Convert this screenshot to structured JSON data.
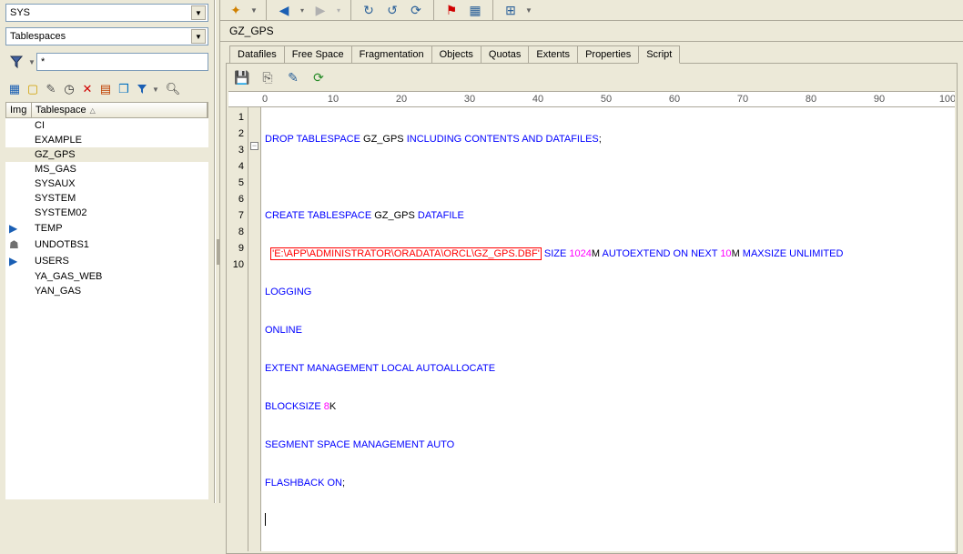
{
  "left": {
    "combo1": "SYS",
    "combo2": "Tablespaces",
    "filter_input": "*",
    "headers": {
      "img": "Img",
      "tablespace": "Tablespace"
    },
    "rows": [
      {
        "icon": "",
        "name": "CI",
        "selected": false
      },
      {
        "icon": "",
        "name": "EXAMPLE",
        "selected": false
      },
      {
        "icon": "",
        "name": "GZ_GPS",
        "selected": true
      },
      {
        "icon": "",
        "name": "MS_GAS",
        "selected": false
      },
      {
        "icon": "",
        "name": "SYSAUX",
        "selected": false
      },
      {
        "icon": "",
        "name": "SYSTEM",
        "selected": false
      },
      {
        "icon": "",
        "name": "SYSTEM02",
        "selected": false
      },
      {
        "icon": "▶",
        "name": "TEMP",
        "selected": false
      },
      {
        "icon": "☗",
        "name": "UNDOTBS1",
        "selected": false
      },
      {
        "icon": "▶",
        "name": "USERS",
        "selected": false
      },
      {
        "icon": "",
        "name": "YA_GAS_WEB",
        "selected": false
      },
      {
        "icon": "",
        "name": "YAN_GAS",
        "selected": false
      }
    ]
  },
  "title": "GZ_GPS",
  "tabs": [
    "Datafiles",
    "Free Space",
    "Fragmentation",
    "Objects",
    "Quotas",
    "Extents",
    "Properties",
    "Script"
  ],
  "active_tab": 7,
  "ruler": [
    "0",
    "10",
    "20",
    "30",
    "40",
    "50",
    "60",
    "70",
    "80",
    "90",
    "100"
  ],
  "code_lines": [
    "1",
    "2",
    "3",
    "4",
    "5",
    "6",
    "7",
    "8",
    "9",
    "10"
  ],
  "sql": {
    "l1": {
      "kw1": "DROP TABLESPACE",
      "id": " GZ_GPS ",
      "kw2": "INCLUDING CONTENTS AND DATAFILES",
      "semi": ";"
    },
    "l3": {
      "kw1": "CREATE TABLESPACE",
      "id": " GZ_GPS ",
      "kw2": "DATAFILE"
    },
    "l4": {
      "str": "'E:\\APP\\ADMINISTRATOR\\ORADATA\\ORCL\\GZ_GPS.DBF'",
      "kw1": " SIZE ",
      "n1": "1024",
      "u1": "M ",
      "kw2": "AUTOEXTEND ON NEXT ",
      "n2": "10",
      "u2": "M ",
      "kw3": "MAXSIZE UNLIMITED"
    },
    "l5": "LOGGING",
    "l6": "ONLINE",
    "l7": "EXTENT MANAGEMENT LOCAL AUTOALLOCATE",
    "l8": {
      "kw": "BLOCKSIZE ",
      "n": "8",
      "u": "K"
    },
    "l9": "SEGMENT SPACE MANAGEMENT AUTO",
    "l10": {
      "kw": "FLASHBACK ON",
      "semi": ";"
    }
  }
}
